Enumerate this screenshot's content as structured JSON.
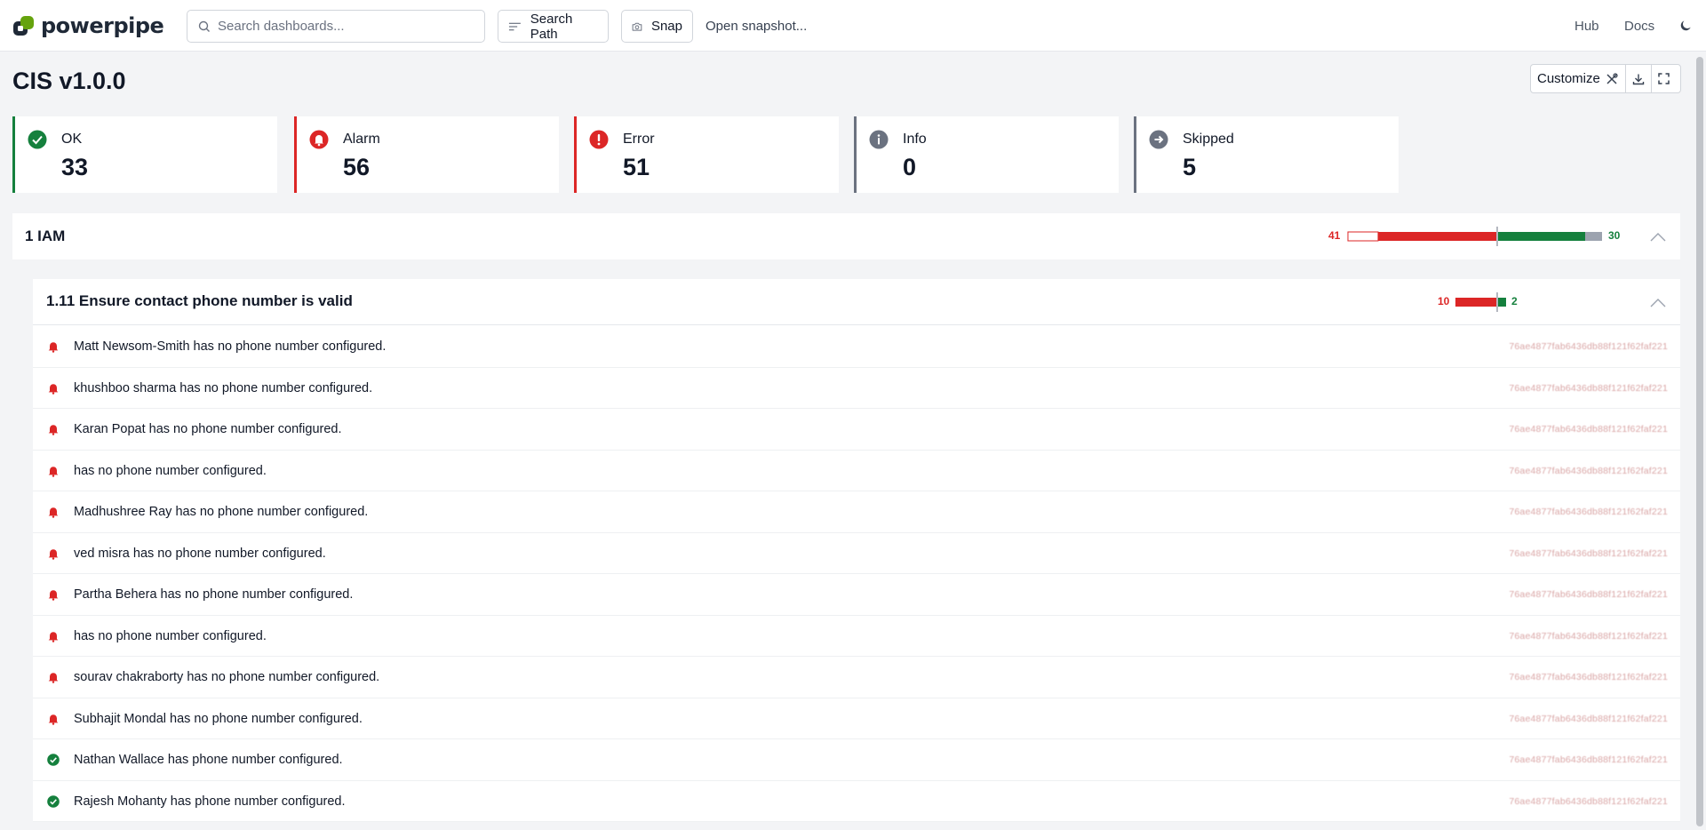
{
  "header": {
    "logo_text": "powerpipe",
    "search_placeholder": "Search dashboards...",
    "search_path_label": "Search Path",
    "snap_label": "Snap",
    "open_snapshot_label": "Open snapshot...",
    "hub_label": "Hub",
    "docs_label": "Docs"
  },
  "page": {
    "title": "CIS v1.0.0",
    "customize_label": "Customize"
  },
  "summary": [
    {
      "label": "OK",
      "value": "33",
      "color": "#15803d",
      "icon": "check-circle-icon"
    },
    {
      "label": "Alarm",
      "value": "56",
      "color": "#dc2626",
      "icon": "bell-icon"
    },
    {
      "label": "Error",
      "value": "51",
      "color": "#dc2626",
      "icon": "exclamation-circle-icon"
    },
    {
      "label": "Info",
      "value": "0",
      "color": "#6b7280",
      "icon": "info-circle-icon"
    },
    {
      "label": "Skipped",
      "value": "5",
      "color": "#6b7280",
      "icon": "arrow-circle-icon"
    }
  ],
  "group": {
    "title": "1 IAM",
    "left_count": "41",
    "right_count": "30"
  },
  "control": {
    "title": "1.11 Ensure contact phone number is valid",
    "left_count": "10",
    "right_count": "2",
    "rows": [
      {
        "status": "alarm",
        "text": "Matt Newsom-Smith has no phone number configured.",
        "id": "76ae4877fab6436db88f121f62faf221"
      },
      {
        "status": "alarm",
        "text": "khushboo sharma has no phone number configured.",
        "id": "76ae4877fab6436db88f121f62faf221"
      },
      {
        "status": "alarm",
        "text": "Karan Popat has no phone number configured.",
        "id": "76ae4877fab6436db88f121f62faf221"
      },
      {
        "status": "alarm",
        "text": " has no phone number configured.",
        "id": "76ae4877fab6436db88f121f62faf221"
      },
      {
        "status": "alarm",
        "text": "Madhushree Ray has no phone number configured.",
        "id": "76ae4877fab6436db88f121f62faf221"
      },
      {
        "status": "alarm",
        "text": "ved misra has no phone number configured.",
        "id": "76ae4877fab6436db88f121f62faf221"
      },
      {
        "status": "alarm",
        "text": "Partha Behera has no phone number configured.",
        "id": "76ae4877fab6436db88f121f62faf221"
      },
      {
        "status": "alarm",
        "text": " has no phone number configured.",
        "id": "76ae4877fab6436db88f121f62faf221"
      },
      {
        "status": "alarm",
        "text": "sourav chakraborty has no phone number configured.",
        "id": "76ae4877fab6436db88f121f62faf221"
      },
      {
        "status": "alarm",
        "text": "Subhajit Mondal has no phone number configured.",
        "id": "76ae4877fab6436db88f121f62faf221"
      },
      {
        "status": "ok",
        "text": "Nathan Wallace has phone number configured.",
        "id": "76ae4877fab6436db88f121f62faf221"
      },
      {
        "status": "ok",
        "text": "Rajesh Mohanty has phone number configured.",
        "id": "76ae4877fab6436db88f121f62faf221"
      }
    ]
  },
  "colors": {
    "ok": "#15803d",
    "alarm": "#dc2626",
    "neutral": "#6b7280"
  }
}
